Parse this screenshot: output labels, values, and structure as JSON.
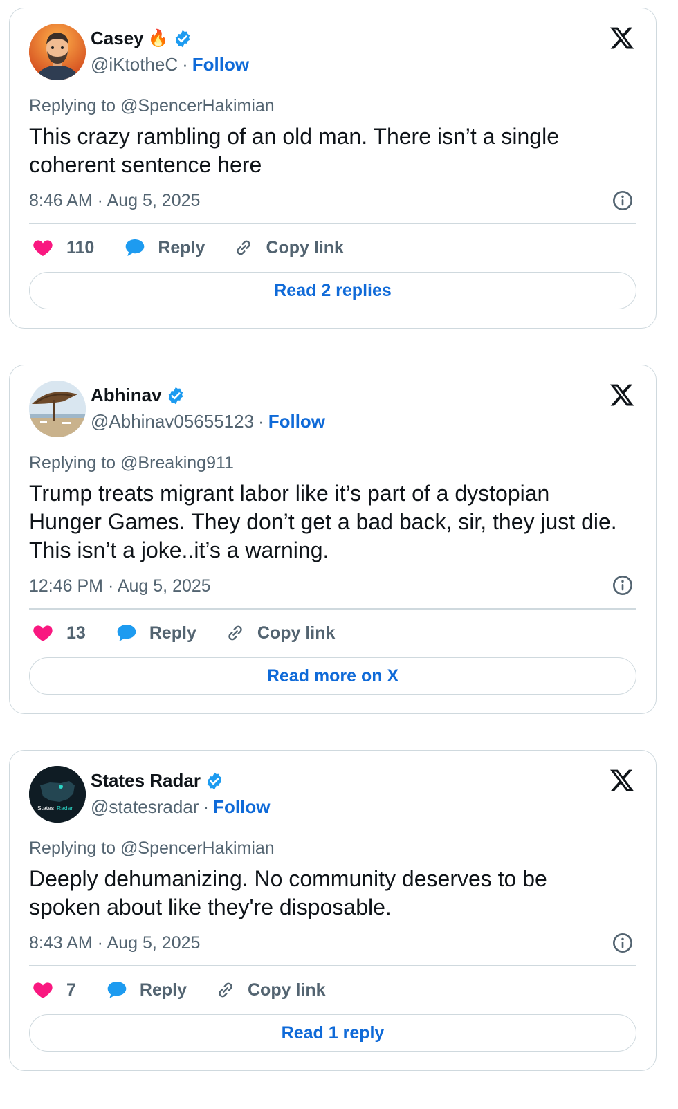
{
  "colors": {
    "accent": "#0f6ad8",
    "verified": "#1d9bf0",
    "heart": "#f91880",
    "secondary_text": "#536471",
    "border": "#cfd9de"
  },
  "tweets": [
    {
      "name": "Casey",
      "emoji": "🔥",
      "verified": true,
      "handle": "@iKtotheC",
      "separator": "·",
      "follow": "Follow",
      "replying_to": "Replying to @SpencerHakimian",
      "text": "This crazy rambling of an old man. There isn’t a single coherent sentence here",
      "timestamp": "8:46 AM · Aug 5, 2025",
      "likes": "110",
      "reply_label": "Reply",
      "copy_label": "Copy link",
      "read_label": "Read 2 replies",
      "avatar_icon": "bearded-man-avatar"
    },
    {
      "name": "Abhinav",
      "verified": true,
      "handle": "@Abhinav05655123",
      "separator": "·",
      "follow": "Follow",
      "replying_to": "Replying to @Breaking911",
      "text": "Trump treats migrant labor like it’s part of a dystopian Hunger Games. They don’t get a bad back, sir, they just die. This isn’t a joke..it’s a warning.",
      "timestamp": "12:46 PM · Aug 5, 2025",
      "likes": "13",
      "reply_label": "Reply",
      "copy_label": "Copy link",
      "read_label": "Read more on X",
      "avatar_icon": "beach-umbrella-avatar"
    },
    {
      "name": "States Radar",
      "verified": true,
      "handle": "@statesradar",
      "separator": "·",
      "follow": "Follow",
      "replying_to": "Replying to @SpencerHakimian",
      "text": "Deeply dehumanizing. No community deserves to be spoken about like they're disposable.",
      "timestamp": "8:43 AM · Aug 5, 2025",
      "likes": "7",
      "reply_label": "Reply",
      "copy_label": "Copy link",
      "read_label": "Read 1 reply",
      "avatar_icon": "states-radar-logo-avatar",
      "avatar_text_a": "States",
      "avatar_text_b": "Radar"
    }
  ]
}
